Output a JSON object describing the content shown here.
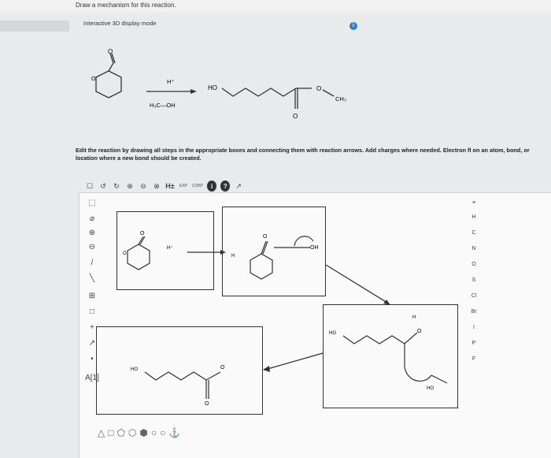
{
  "header": {
    "title": "Draw a mechanism for this reaction.",
    "subtitle": "Interactive 3D display mode",
    "info_icon": "i"
  },
  "reaction": {
    "reagent_top": "H⁺",
    "reagent_bottom": "H₃C—OH",
    "product_ho": "HO",
    "product_ring_o": "O",
    "product_ch3": "CH₃",
    "product_carbonyl_o": "O",
    "reactant_carbonyl_o": "O",
    "reactant_ring_o": "O"
  },
  "instructions": "Edit the reaction by drawing all steps in the appropriate boxes and connecting them with reaction arrows. Add charges where needed. Electron fl on an atom, bond, or location where a new bond should be created.",
  "toolbar": {
    "items": [
      "☐",
      "↺",
      "↻",
      "⊕",
      "⊖",
      "⊗",
      "H±",
      "EXP",
      "CONT",
      "i",
      "?",
      "↗"
    ]
  },
  "left_tools": [
    "⬚",
    "⌀",
    "⊕",
    "⊖",
    "/",
    "╲",
    "⊞",
    "□",
    "+",
    "↗",
    "•",
    "A[1]"
  ],
  "elements": [
    "H",
    "C",
    "N",
    "O",
    "S",
    "Cl",
    "Br",
    "I",
    "P",
    "F"
  ],
  "element_header": "≡",
  "boxes": {
    "box1": {
      "h_plus": "H⁺",
      "o": "O",
      "ring_o": "O"
    },
    "box2": {
      "h": "H",
      "o": "O",
      "oh": "OH"
    },
    "box3": {
      "ho": "HO",
      "h": "H",
      "o": "O",
      "ho2": "HO"
    },
    "box4": {
      "ho": "HO",
      "o": "O",
      "o2": "O"
    }
  },
  "shapes": [
    "△",
    "□",
    "⬠",
    "⬡",
    "⬢",
    "○",
    "○",
    "⚓"
  ]
}
